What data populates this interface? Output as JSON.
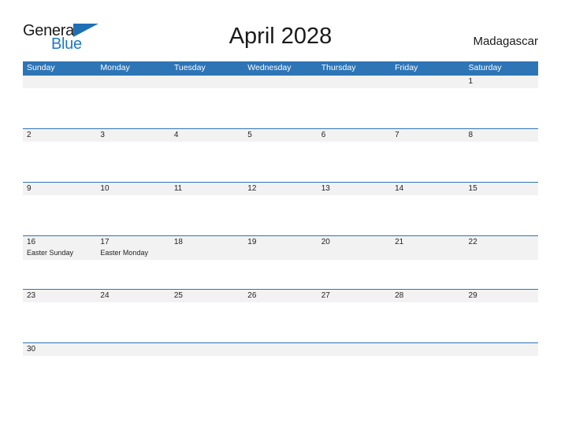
{
  "brand": {
    "name_top": "General",
    "name_bottom": "Blue",
    "flag_icon": "triangle-flag-icon",
    "color_dark": "#1a1a1a",
    "color_blue": "#1f7ac4"
  },
  "header": {
    "title": "April 2028",
    "country": "Madagascar"
  },
  "colors": {
    "header_blue": "#2e75b6",
    "row_band": "#f2f2f2",
    "text": "#222222",
    "page_background": "#ffffff"
  },
  "calendar": {
    "weekday_names": [
      "Sunday",
      "Monday",
      "Tuesday",
      "Wednesday",
      "Thursday",
      "Friday",
      "Saturday"
    ],
    "weeks": [
      [
        {
          "day": "",
          "event": ""
        },
        {
          "day": "",
          "event": ""
        },
        {
          "day": "",
          "event": ""
        },
        {
          "day": "",
          "event": ""
        },
        {
          "day": "",
          "event": ""
        },
        {
          "day": "",
          "event": ""
        },
        {
          "day": "1",
          "event": ""
        }
      ],
      [
        {
          "day": "2",
          "event": ""
        },
        {
          "day": "3",
          "event": ""
        },
        {
          "day": "4",
          "event": ""
        },
        {
          "day": "5",
          "event": ""
        },
        {
          "day": "6",
          "event": ""
        },
        {
          "day": "7",
          "event": ""
        },
        {
          "day": "8",
          "event": ""
        }
      ],
      [
        {
          "day": "9",
          "event": ""
        },
        {
          "day": "10",
          "event": ""
        },
        {
          "day": "11",
          "event": ""
        },
        {
          "day": "12",
          "event": ""
        },
        {
          "day": "13",
          "event": ""
        },
        {
          "day": "14",
          "event": ""
        },
        {
          "day": "15",
          "event": ""
        }
      ],
      [
        {
          "day": "16",
          "event": "Easter Sunday"
        },
        {
          "day": "17",
          "event": "Easter Monday"
        },
        {
          "day": "18",
          "event": ""
        },
        {
          "day": "19",
          "event": ""
        },
        {
          "day": "20",
          "event": ""
        },
        {
          "day": "21",
          "event": ""
        },
        {
          "day": "22",
          "event": ""
        }
      ],
      [
        {
          "day": "23",
          "event": ""
        },
        {
          "day": "24",
          "event": ""
        },
        {
          "day": "25",
          "event": ""
        },
        {
          "day": "26",
          "event": ""
        },
        {
          "day": "27",
          "event": ""
        },
        {
          "day": "28",
          "event": ""
        },
        {
          "day": "29",
          "event": ""
        }
      ],
      [
        {
          "day": "30",
          "event": ""
        },
        {
          "day": "",
          "event": ""
        },
        {
          "day": "",
          "event": ""
        },
        {
          "day": "",
          "event": ""
        },
        {
          "day": "",
          "event": ""
        },
        {
          "day": "",
          "event": ""
        },
        {
          "day": "",
          "event": ""
        }
      ]
    ]
  }
}
